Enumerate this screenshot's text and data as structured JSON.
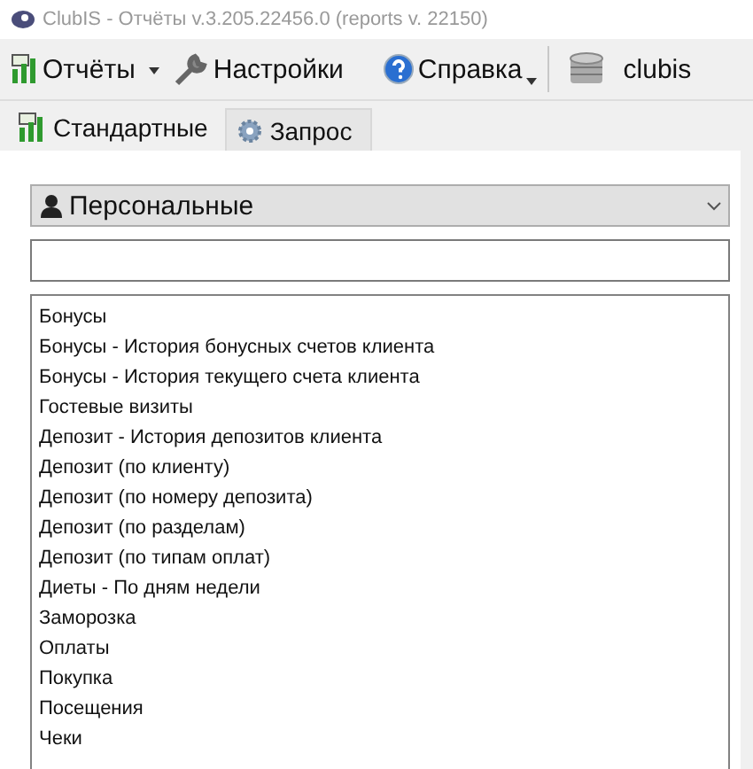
{
  "window": {
    "title": "ClubIS - Отчёты v.3.205.22456.0 (reports v. 22150)"
  },
  "toolbar": [
    {
      "kind": "split",
      "label": "Отчёты"
    },
    {
      "kind": "button",
      "label": "Настройки"
    },
    {
      "kind": "menu",
      "label": "Справка"
    },
    {
      "kind": "db",
      "label": "clubis"
    }
  ],
  "tabs": [
    {
      "label": "Стандартные",
      "selected": true
    },
    {
      "label": "Запрос",
      "selected": false
    }
  ],
  "category": {
    "value": "Персональные"
  },
  "reports": [
    "Бонусы",
    "Бонусы - История бонусных счетов клиента",
    "Бонусы - История текущего счета клиента",
    "Гостевые визиты",
    "Депозит - История депозитов клиента",
    "Депозит (по клиенту)",
    "Депозит (по номеру депозита)",
    "Депозит (по разделам)",
    "Депозит (по типам оплат)",
    "Диеты - По дням недели",
    "Заморозка",
    "Оплаты",
    "Покупка",
    "Посещения",
    "Чеки"
  ]
}
